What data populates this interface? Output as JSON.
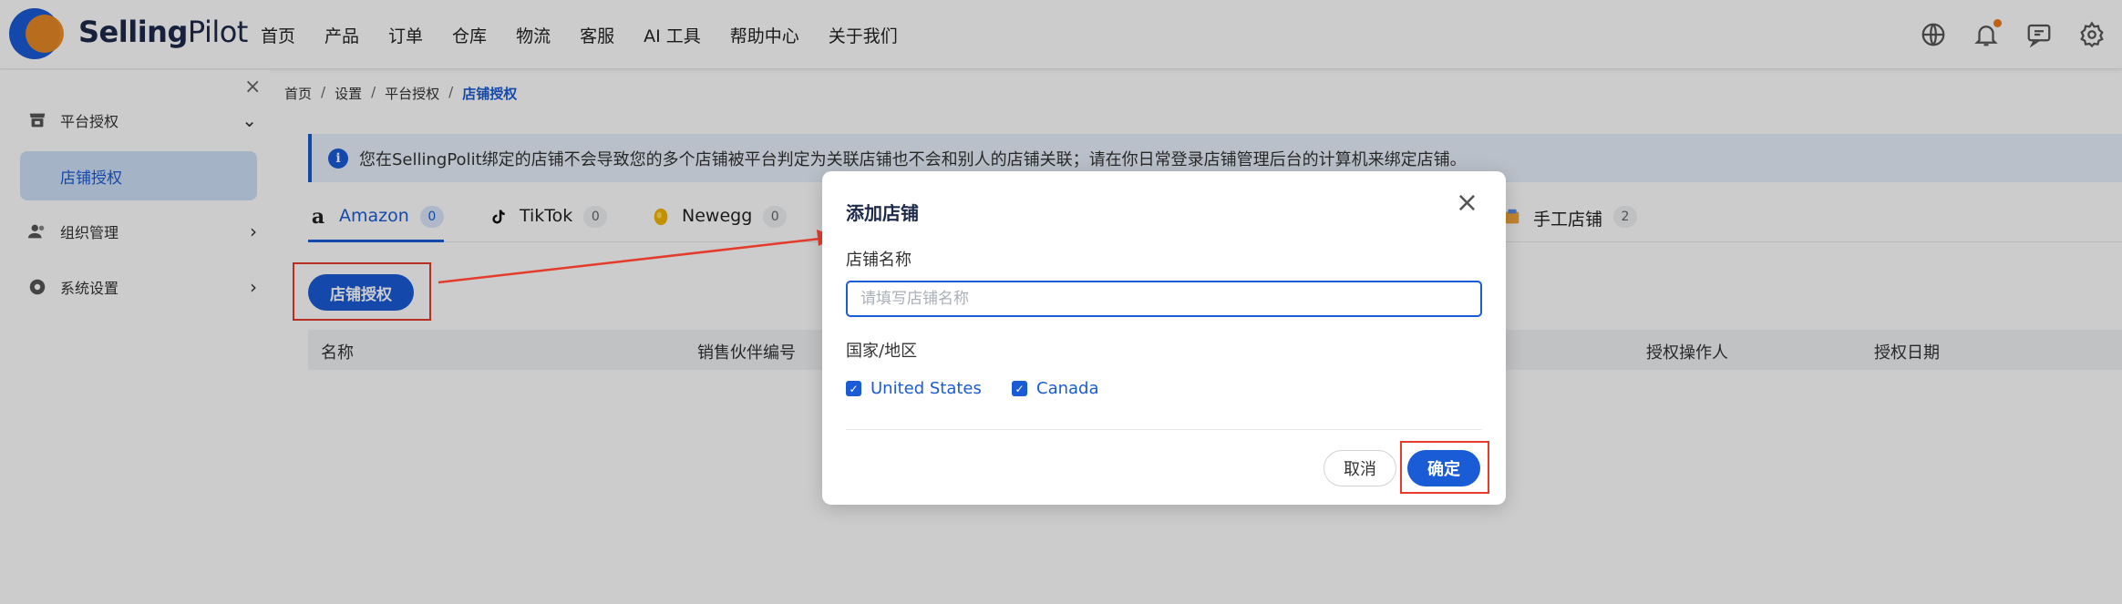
{
  "brand": {
    "bold": "Selling",
    "rest": "Pilot"
  },
  "nav": [
    "首页",
    "产品",
    "订单",
    "仓库",
    "物流",
    "客服",
    "AI 工具",
    "帮助中心",
    "关于我们"
  ],
  "header_icons": [
    "globe-icon",
    "bell-icon",
    "message-icon",
    "gear-icon"
  ],
  "sidebar": {
    "close": "×",
    "groups": [
      {
        "label": "平台授权",
        "icon": "store-icon",
        "chevron": "⌄"
      },
      {
        "label": "组织管理",
        "icon": "users-icon",
        "chevron": "›"
      },
      {
        "label": "系统设置",
        "icon": "settings-icon",
        "chevron": "›"
      }
    ],
    "active_sub": "店铺授权"
  },
  "breadcrumb": [
    "首页",
    "设置",
    "平台授权",
    "店铺授权"
  ],
  "breadcrumb_sep": "/",
  "notice": "您在SellingPolit绑定的店铺不会导致您的多个店铺被平台判定为关联店铺也不会和别人的店铺关联；请在你日常登录店铺管理后台的计算机来绑定店铺。",
  "tabs": [
    {
      "label": "Amazon",
      "count": "0"
    },
    {
      "label": "TikTok",
      "count": "0"
    },
    {
      "label": "Newegg",
      "count": "0"
    },
    {
      "label": "手工店铺",
      "count": "2"
    }
  ],
  "auth_button": "店铺授权",
  "table_columns": [
    "名称",
    "销售伙伴编号",
    "授权操作人",
    "授权日期"
  ],
  "modal": {
    "title": "添加店铺",
    "close": "×",
    "name_label": "店铺名称",
    "name_placeholder": "请填写店铺名称",
    "region_label": "国家/地区",
    "regions": [
      "United States",
      "Canada"
    ],
    "cancel": "取消",
    "confirm": "确定"
  },
  "colors": {
    "accent": "#1a5bd6",
    "brand_orange": "#f08a1c",
    "highlight": "#e53b2c"
  }
}
